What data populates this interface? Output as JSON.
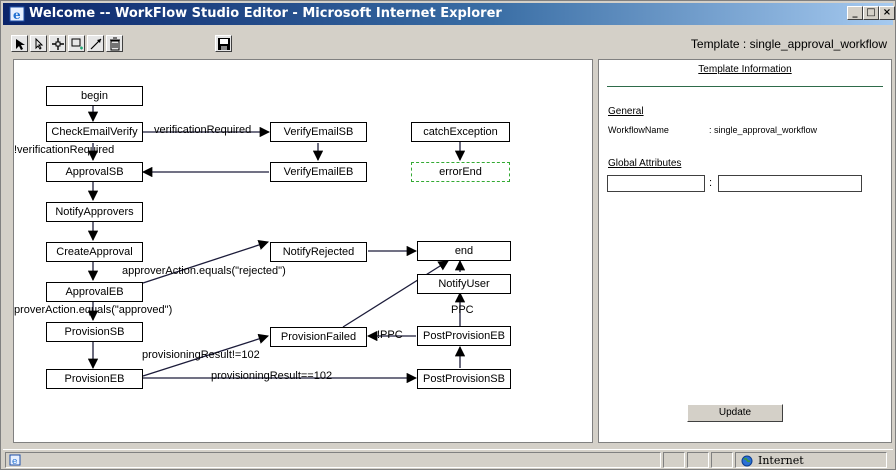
{
  "window": {
    "title": "Welcome -- WorkFlow Studio Editor - Microsoft Internet Explorer",
    "buttons": {
      "minimize": "_",
      "maximize": "□",
      "close": "×"
    }
  },
  "toolbar": {
    "tools": [
      "select-arrow-icon",
      "pointer-icon",
      "move-icon",
      "add-node-icon",
      "connect-icon",
      "delete-icon",
      "save-icon"
    ],
    "template_label": "Template : single_approval_workflow"
  },
  "workflow": {
    "nodes": {
      "begin": "begin",
      "check_email_verify": "CheckEmailVerify",
      "verify_email_sb": "VerifyEmailSB",
      "catch_exception": "catchException",
      "approval_sb": "ApprovalSB",
      "verify_email_eb": "VerifyEmailEB",
      "error_end": "errorEnd",
      "notify_approvers": "NotifyApprovers",
      "create_approval": "CreateApproval",
      "notify_rejected": "NotifyRejected",
      "end": "end",
      "approval_eb": "ApprovalEB",
      "notify_user": "NotifyUser",
      "provision_sb": "ProvisionSB",
      "provision_failed": "ProvisionFailed",
      "post_provision_eb": "PostProvisionEB",
      "provision_eb": "ProvisionEB",
      "post_provision_sb": "PostProvisionSB"
    },
    "edge_labels": {
      "verification_required": "verificationRequired",
      "not_verification_required": "!verificationRequired",
      "rejected": "approverAction.equals(\"rejected\")",
      "approved": "proverAction.equals(\"approved\")",
      "result_not_102": "provisioningResult!=102",
      "result_eq_102": "provisioningResult==102",
      "ppc": "PPC",
      "not_ppc": "!PPC"
    }
  },
  "panel": {
    "title": "Template Information",
    "general_heading": "General",
    "workflow_name_label": "WorkflowName",
    "workflow_name_value": ": single_approval_workflow",
    "global_attributes_heading": "Global Attributes",
    "attr_separator": ":",
    "attr_key_value": "",
    "attr_value_value": "",
    "update_label": "Update"
  },
  "status": {
    "zone": "Internet"
  }
}
